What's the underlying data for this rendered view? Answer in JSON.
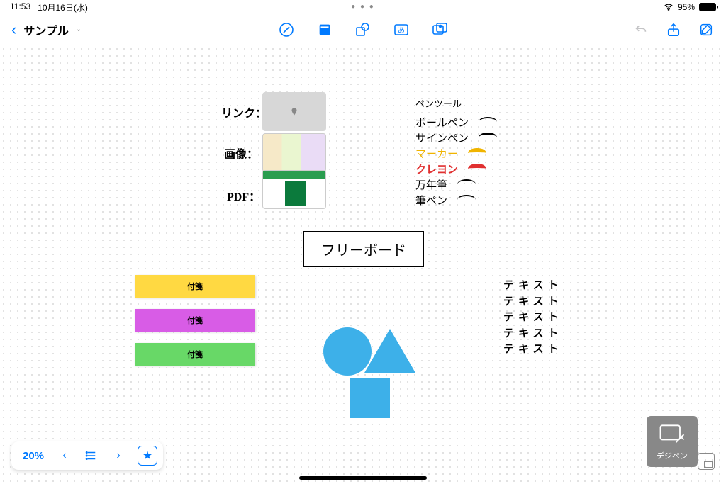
{
  "status": {
    "time": "11:53",
    "date": "10月16日(水)",
    "battery_pct": "95%"
  },
  "toolbar": {
    "title": "サンプル"
  },
  "canvas": {
    "labels": {
      "link": "リンク：",
      "image": "画像：",
      "pdf": "PDF："
    },
    "freeboard": "フリーボード",
    "stickies": {
      "yellow": "付箋",
      "pink": "付箋",
      "green": "付箋"
    },
    "text_block": "テキスト\nテキスト\nテキスト\nテキスト\nテキスト",
    "pens": {
      "title": "ペンツール",
      "items": [
        "ボールペン",
        "サインペン",
        "マーカー",
        "クレヨン",
        "万年筆",
        "筆ペン"
      ]
    }
  },
  "bottom": {
    "zoom": "20%"
  },
  "watermark": "デジペン"
}
